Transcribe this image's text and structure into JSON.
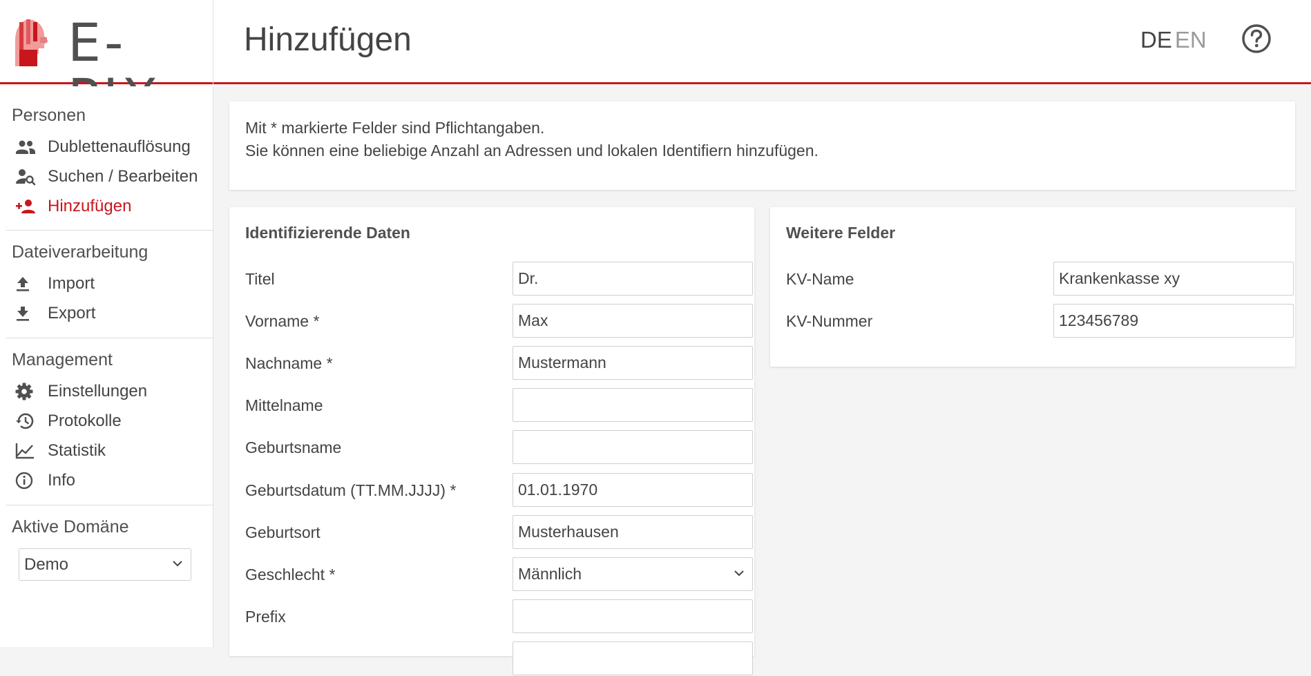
{
  "header": {
    "logo_text": "E-PIX",
    "page_title": "Hinzufügen",
    "lang_de": "DE",
    "lang_en": "EN"
  },
  "sidebar": {
    "sections": [
      {
        "title": "Personen"
      },
      {
        "title": "Dateiverarbeitung"
      },
      {
        "title": "Management"
      },
      {
        "title": "Aktive Domäne"
      }
    ],
    "items": [
      {
        "label": "Dublettenauflösung",
        "icon": "people-icon"
      },
      {
        "label": "Suchen / Bearbeiten",
        "icon": "person-search-icon"
      },
      {
        "label": "Hinzufügen",
        "icon": "person-add-icon",
        "active": true
      },
      {
        "label": "Import",
        "icon": "upload-icon"
      },
      {
        "label": "Export",
        "icon": "download-icon"
      },
      {
        "label": "Einstellungen",
        "icon": "gear-icon"
      },
      {
        "label": "Protokolle",
        "icon": "history-icon"
      },
      {
        "label": "Statistik",
        "icon": "line-chart-icon"
      },
      {
        "label": "Info",
        "icon": "info-icon"
      }
    ],
    "domain_value": "Demo"
  },
  "info": {
    "line1": "Mit * markierte Felder sind Pflichtangaben.",
    "line2": "Sie können eine beliebige Anzahl an Adressen und lokalen Identifiern hinzufügen."
  },
  "identifying": {
    "title": "Identifizierende Daten",
    "fields": [
      {
        "label": "Titel",
        "value": "Dr."
      },
      {
        "label": "Vorname  *",
        "value": "Max"
      },
      {
        "label": "Nachname  *",
        "value": "Mustermann"
      },
      {
        "label": "Mittelname",
        "value": ""
      },
      {
        "label": "Geburtsname",
        "value": ""
      },
      {
        "label": "Geburtsdatum (TT.MM.JJJJ)  *",
        "value": "01.01.1970"
      },
      {
        "label": "Geburtsort",
        "value": "Musterhausen"
      },
      {
        "label": "Geschlecht  *",
        "value": "Männlich"
      },
      {
        "label": "Prefix",
        "value": ""
      }
    ]
  },
  "extra": {
    "title": "Weitere Felder",
    "fields": [
      {
        "label": "KV-Name",
        "value": "Krankenkasse xy"
      },
      {
        "label": "KV-Nummer",
        "value": "123456789"
      }
    ]
  },
  "colors": {
    "accent": "#c8161d",
    "text": "#444444",
    "background": "#f4f4f4"
  }
}
